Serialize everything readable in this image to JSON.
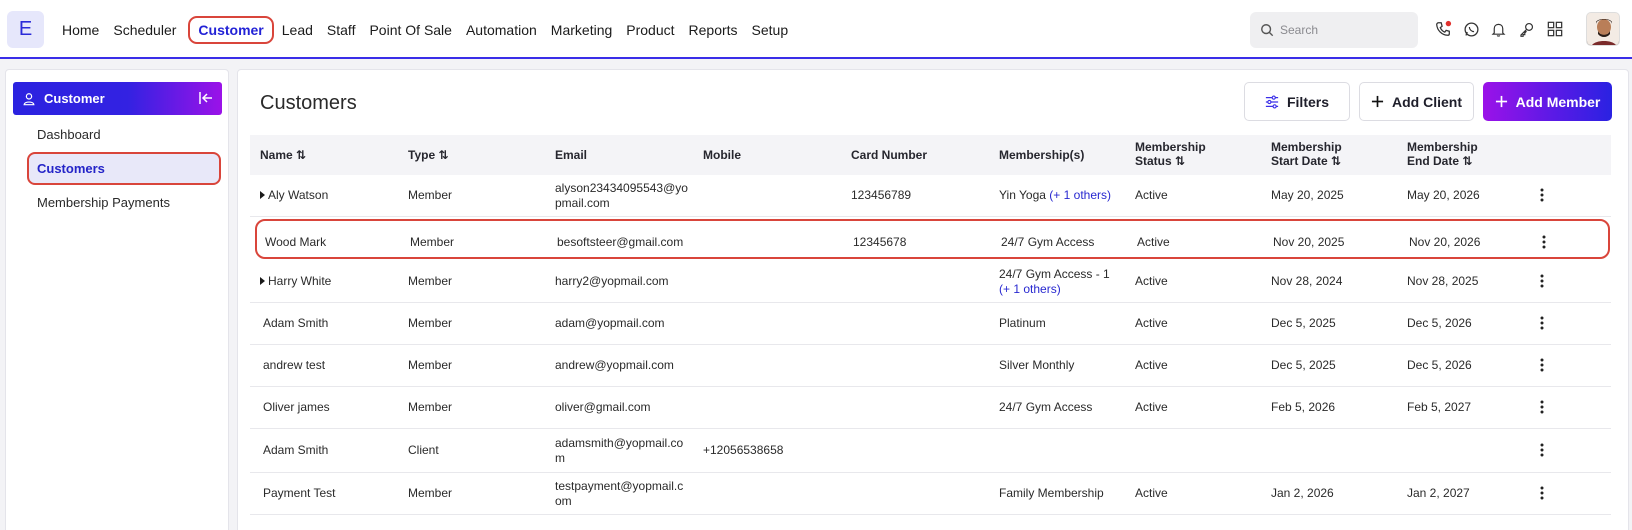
{
  "app": {
    "logo_letter": "E",
    "accent": "#3a2ee8",
    "highlight": "#d9453b"
  },
  "nav": {
    "items": [
      {
        "label": "Home"
      },
      {
        "label": "Scheduler"
      },
      {
        "label": "Customer",
        "active": true
      },
      {
        "label": "Lead"
      },
      {
        "label": "Staff"
      },
      {
        "label": "Point Of Sale"
      },
      {
        "label": "Automation"
      },
      {
        "label": "Marketing"
      },
      {
        "label": "Product"
      },
      {
        "label": "Reports"
      },
      {
        "label": "Setup"
      }
    ],
    "search_placeholder": "Search",
    "icons": [
      "phone-icon",
      "whatsapp-icon",
      "bell-icon",
      "key-icon",
      "apps-grid-icon"
    ]
  },
  "sidebar": {
    "header": "Customer",
    "items": [
      {
        "label": "Dashboard"
      },
      {
        "label": "Customers",
        "active": true
      },
      {
        "label": "Membership Payments"
      }
    ]
  },
  "main": {
    "title": "Customers",
    "buttons": {
      "filters": "Filters",
      "add_client": "Add Client",
      "add_member": "Add Member"
    },
    "columns": {
      "name": "Name",
      "type": "Type",
      "email": "Email",
      "mobile": "Mobile",
      "card": "Card Number",
      "memberships": "Membership(s)",
      "status_l1": "Membership",
      "status_l2": "Status",
      "start_l1": "Membership",
      "start_l2": "Start Date",
      "end_l1": "Membership",
      "end_l2": "End Date"
    },
    "rows": [
      {
        "name": "Aly Watson",
        "expandable": true,
        "type": "Member",
        "email_l1": "alyson23434095543@yo",
        "email_l2": "pmail.com",
        "mobile": "",
        "card": "123456789",
        "membership": "Yin Yoga",
        "others_inline": "(+ 1 others)",
        "others_below": "",
        "status": "Active",
        "start": "May 20, 2025",
        "end": "May 20, 2026"
      },
      {
        "name": "Wood Mark",
        "expandable": false,
        "type": "Member",
        "email_l1": "besoftsteer@gmail.com",
        "email_l2": "",
        "mobile": "",
        "card": "12345678",
        "membership": "24/7 Gym Access",
        "others_inline": "",
        "others_below": "",
        "status": "Active",
        "start": "Nov 20, 2025",
        "end": "Nov 20, 2026"
      },
      {
        "name": "Harry White",
        "expandable": true,
        "type": "Member",
        "email_l1": "harry2@yopmail.com",
        "email_l2": "",
        "mobile": "",
        "card": "",
        "membership": "24/7 Gym Access - 1",
        "others_inline": "",
        "others_below": "(+ 1 others)",
        "status": "Active",
        "start": "Nov 28, 2024",
        "end": "Nov 28, 2025"
      },
      {
        "name": "Adam Smith",
        "expandable": false,
        "type": "Member",
        "email_l1": "adam@yopmail.com",
        "email_l2": "",
        "mobile": "",
        "card": "",
        "membership": "Platinum",
        "others_inline": "",
        "others_below": "",
        "status": "Active",
        "start": "Dec 5, 2025",
        "end": "Dec 5, 2026"
      },
      {
        "name": "andrew test",
        "expandable": false,
        "type": "Member",
        "email_l1": "andrew@yopmail.com",
        "email_l2": "",
        "mobile": "",
        "card": "",
        "membership": "Silver Monthly",
        "others_inline": "",
        "others_below": "",
        "status": "Active",
        "start": "Dec 5, 2025",
        "end": "Dec 5, 2026"
      },
      {
        "name": "Oliver james",
        "expandable": false,
        "type": "Member",
        "email_l1": "oliver@gmail.com",
        "email_l2": "",
        "mobile": "",
        "card": "",
        "membership": "24/7 Gym Access",
        "others_inline": "",
        "others_below": "",
        "status": "Active",
        "start": "Feb 5, 2026",
        "end": "Feb 5, 2027"
      },
      {
        "name": "Adam Smith",
        "expandable": false,
        "type": "Client",
        "email_l1": "adamsmith@yopmail.co",
        "email_l2": "m",
        "mobile": "+12056538658",
        "card": "",
        "membership": "",
        "others_inline": "",
        "others_below": "",
        "status": "",
        "start": "",
        "end": ""
      },
      {
        "name": "Payment Test",
        "expandable": false,
        "type": "Member",
        "email_l1": "testpayment@yopmail.c",
        "email_l2": "om",
        "mobile": "",
        "card": "",
        "membership": "Family Membership",
        "others_inline": "",
        "others_below": "",
        "status": "Active",
        "start": "Jan 2, 2026",
        "end": "Jan 2, 2027"
      }
    ]
  }
}
